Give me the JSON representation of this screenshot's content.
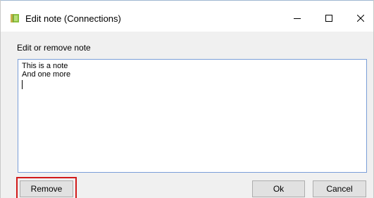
{
  "window": {
    "title": "Edit note (Connections)",
    "icon": "notebook-icon",
    "controls": {
      "minimize_icon": "minimize-icon",
      "maximize_icon": "maximize-icon",
      "close_icon": "close-icon"
    }
  },
  "dialog": {
    "section_label": "Edit or remove note",
    "note_text": "This is a note\nAnd one more\n"
  },
  "buttons": {
    "remove_label": "Remove",
    "ok_label": "Ok",
    "cancel_label": "Cancel"
  },
  "colors": {
    "highlight": "#d11a1a",
    "textarea_border": "#7a9ed8",
    "dialog_background": "#f0f0f0"
  }
}
